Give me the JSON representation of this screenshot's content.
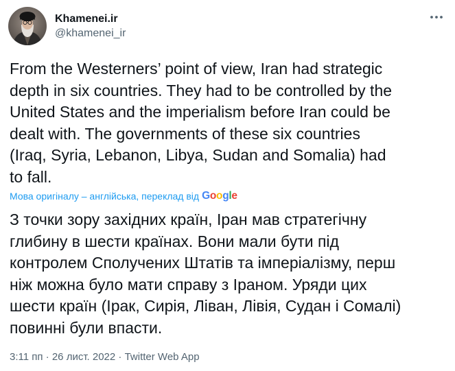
{
  "account": {
    "display_name": "Khamenei.ir",
    "handle": "@khamenei_ir"
  },
  "tweet": {
    "original_text": "From the Westerners’ point of view, Iran had strategic\ndepth in six countries. They had to be controlled by the\nUnited States and the imperialism before Iran could be\ndealt with. The governments of these six countries\n(Iraq, Syria, Lebanon, Libya, Sudan and Somalia) had\nto fall.",
    "translation_label": "Мова оригіналу – англійська, переклад від",
    "translation_provider": "Google",
    "translated_text": "З точки зору західних країн, Іран мав стратегічну\nглибину в шести країнах. Вони мали бути під\nконтролем Сполучених Штатів та імперіалізму, перш\nніж можна було мати справу з Іраном. Уряди цих\nшести країн (Ірак, Сирія, Ліван, Лівія, Судан і Сомалі)\nповинні були впасти.",
    "time": "3:11 пп",
    "separator": "·",
    "date": "26 лист. 2022",
    "source": "Twitter Web App"
  },
  "icons": {
    "more": "more-horizontal-icon",
    "avatar": "profile-photo"
  },
  "colors": {
    "text_primary": "#0f1419",
    "text_secondary": "#536471",
    "link": "#1d9bf0",
    "google_blue": "#4285f4",
    "google_red": "#ea4335",
    "google_yellow": "#fbbc05",
    "google_green": "#34a853"
  }
}
